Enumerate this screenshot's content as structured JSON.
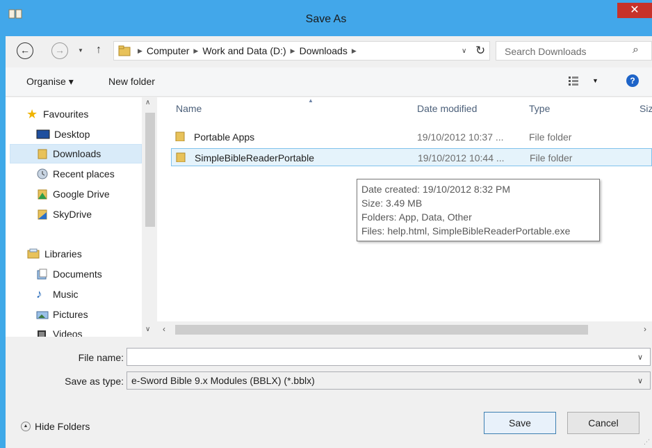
{
  "window": {
    "title": "Save As",
    "close_glyph": "✕"
  },
  "address": {
    "crumbs": [
      "Computer",
      "Work and Data (D:)",
      "Downloads"
    ],
    "search_placeholder": "Search Downloads"
  },
  "toolbar": {
    "organise_label": "Organise ▾",
    "new_folder_label": "New folder"
  },
  "nav": {
    "favourites": "Favourites",
    "items": [
      {
        "label": "Desktop",
        "icon": "desktop-icon"
      },
      {
        "label": "Downloads",
        "icon": "folder-icon",
        "selected": true
      },
      {
        "label": "Recent places",
        "icon": "recent-places-icon"
      },
      {
        "label": "Google Drive",
        "icon": "google-drive-icon"
      },
      {
        "label": "SkyDrive",
        "icon": "skydrive-icon"
      }
    ],
    "libraries": "Libraries",
    "library_items": [
      "Documents",
      "Music",
      "Pictures",
      "Videos"
    ]
  },
  "files": {
    "columns": [
      "Name",
      "Date modified",
      "Type",
      "Siz"
    ],
    "rows": [
      {
        "name": "Portable Apps",
        "date": "19/10/2012 10:37 ...",
        "type": "File folder"
      },
      {
        "name": "SimpleBibleReaderPortable",
        "date": "19/10/2012 10:44 ...",
        "type": "File folder",
        "selected": true
      }
    ]
  },
  "tooltip": {
    "created": "Date created: 19/10/2012 8:32 PM",
    "size": "Size: 3.49 MB",
    "folders": "Folders: App, Data, Other",
    "files": "Files: help.html, SimpleBibleReaderPortable.exe"
  },
  "form": {
    "file_name_label": "File name:",
    "file_name_value": "",
    "type_label": "Save as type:",
    "type_value": "e-Sword Bible 9.x Modules (BBLX) (*.bblx)"
  },
  "footer": {
    "hide_folders": "Hide Folders",
    "save": "Save",
    "cancel": "Cancel"
  }
}
